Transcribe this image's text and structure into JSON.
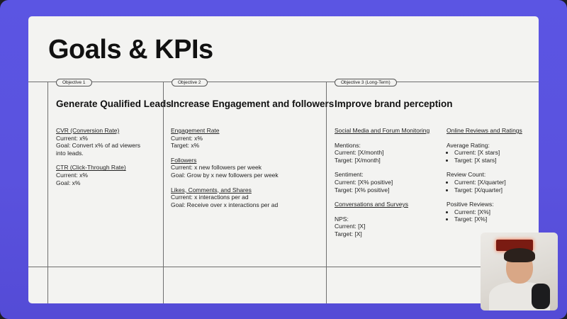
{
  "slide": {
    "title": "Goals & KPIs"
  },
  "objectives": [
    {
      "tag": "Objective 1",
      "heading": "Generate Qualified Leads",
      "blocks": [
        {
          "title": "CVR (Conversion Rate)",
          "lines": [
            "Current: x%",
            "Goal: Convert x% of ad viewers",
            "into leads."
          ]
        },
        {
          "title": "CTR (Click-Through Rate)",
          "lines": [
            "Current: x%",
            "Goal: x%"
          ]
        }
      ]
    },
    {
      "tag": "Objective 2",
      "heading": "Increase Engagement and followers",
      "blocks": [
        {
          "title": "Engagement Rate",
          "lines": [
            "Current: x%",
            "Target: x%"
          ]
        },
        {
          "title": "Followers",
          "lines": [
            "Current: x new followers per week",
            "Goal: Grow by x new followers per week"
          ]
        },
        {
          "title": "Likes, Comments, and Shares",
          "lines": [
            "Current: x interactions per ad",
            "Goal: Receive over x interactions per ad"
          ]
        }
      ]
    },
    {
      "tag": "Objective 3 (Long-Term)",
      "heading": "Improve brand perception",
      "left": {
        "title": "Social Media and Forum Monitoring",
        "mentions": {
          "label": "Mentions:",
          "lines": [
            "Current: [X/month]",
            "Target: [X/month]"
          ]
        },
        "sentiment": {
          "label": "Sentiment:",
          "lines": [
            "Current: [X% positive]",
            "Target: [X% positive]"
          ]
        },
        "conv_title": "Conversations and Surveys",
        "nps": {
          "label": "NPS:",
          "lines": [
            "Current: [X]",
            "Target: [X]"
          ]
        }
      },
      "right": {
        "title": "Online Reviews and Ratings",
        "avg": {
          "label": "Average Rating:",
          "items": [
            "Current: [X stars]",
            "Target: [X stars]"
          ]
        },
        "count": {
          "label": "Review Count:",
          "items": [
            "Current: [X/quarter]",
            "Target: [X/quarter]"
          ]
        },
        "positive": {
          "label": "Positive Reviews:",
          "items": [
            "Current: [X%]",
            "Target: [X%]"
          ]
        }
      }
    }
  ],
  "colors": {
    "background": "#5a52de",
    "slide": "#f3f3f1",
    "grid": "#6f6f6f"
  }
}
